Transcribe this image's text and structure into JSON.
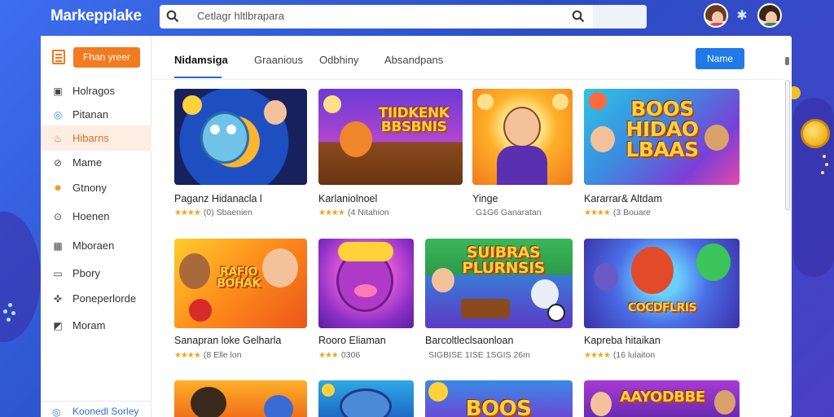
{
  "app": {
    "title": "Markepplake"
  },
  "search": {
    "placeholder": "Cetlagr hltlbrapara"
  },
  "sidebar": {
    "plan_button": "Fhan yreer",
    "items": [
      {
        "label": "Holragos",
        "icon": "bag-icon"
      },
      {
        "label": "Pitanan",
        "icon": "compass-icon"
      },
      {
        "label": "Hibarns",
        "icon": "flame-icon",
        "active": true
      },
      {
        "label": "Mame",
        "icon": "shield-icon"
      },
      {
        "label": "Gtnony",
        "icon": "gear-icon"
      },
      {
        "label": "Hoenen",
        "icon": "coin-icon"
      },
      {
        "label": "Mboraen",
        "icon": "monitor-icon"
      },
      {
        "label": "Pbory",
        "icon": "card-icon"
      },
      {
        "label": "Poneperlorde",
        "icon": "puzzle-icon"
      },
      {
        "label": "Moram",
        "icon": "chart-icon"
      }
    ],
    "bottom": {
      "label": "Koonedl Sorley",
      "icon": "help-icon"
    }
  },
  "tabs": [
    {
      "label": "Nidamsiga",
      "active": true
    },
    {
      "label": "Graanious"
    },
    {
      "label": "Odbhiny"
    },
    {
      "label": "Absandpans"
    }
  ],
  "action_button": "Name",
  "games": [
    {
      "title": "Paganz Hidanacla l",
      "rating_stars": "★★★★",
      "meta": "(0) Sbaenien",
      "art": "teal-hero"
    },
    {
      "title": "Karlaniolnoel",
      "rating_stars": "★★★★",
      "meta": "(4 Nitahion",
      "art": "cat-banner",
      "banner": "TIIDKENK BBSBNIS"
    },
    {
      "title": "Yinge",
      "rating_stars": "",
      "meta": "G1G6 Ganaratan",
      "art": "kid-cheer"
    },
    {
      "title": "Kararrar& Altdam",
      "rating_stars": "★★★★",
      "meta": "(3 Bouare",
      "art": "hidao-banner",
      "banner": "BOOS HIDAO LBAAS"
    },
    {
      "title": "Sanapran loke Gelharla",
      "rating_stars": "★★★★",
      "meta": "(8 Elle lon",
      "art": "boxers",
      "banner": "RAFIO BOHAK"
    },
    {
      "title": "Rooro Eliaman",
      "rating_stars": "★★★",
      "meta": "0306",
      "art": "purple-pup"
    },
    {
      "title": "Barcoltleclsaonloan",
      "rating_stars": "",
      "meta": "SIGBISE 1ISE 1SGIS 26m",
      "art": "plurnsis",
      "banner": "SUIBRAS PLURNSIS"
    },
    {
      "title": "Kapreba hitaikan",
      "rating_stars": "★★★★",
      "meta": "(16 lulaiton",
      "art": "monsters",
      "banner": "COCDFLRIS"
    },
    {
      "title": "",
      "rating_stars": "",
      "meta": "",
      "art": "pirate"
    },
    {
      "title": "",
      "rating_stars": "",
      "meta": "",
      "art": "bluebird"
    },
    {
      "title": "",
      "rating_stars": "",
      "meta": "",
      "art": "boos-bottom",
      "banner": "BOOS"
    },
    {
      "title": "",
      "rating_stars": "",
      "meta": "",
      "art": "arcade",
      "banner": "AAYODBBE"
    }
  ]
}
